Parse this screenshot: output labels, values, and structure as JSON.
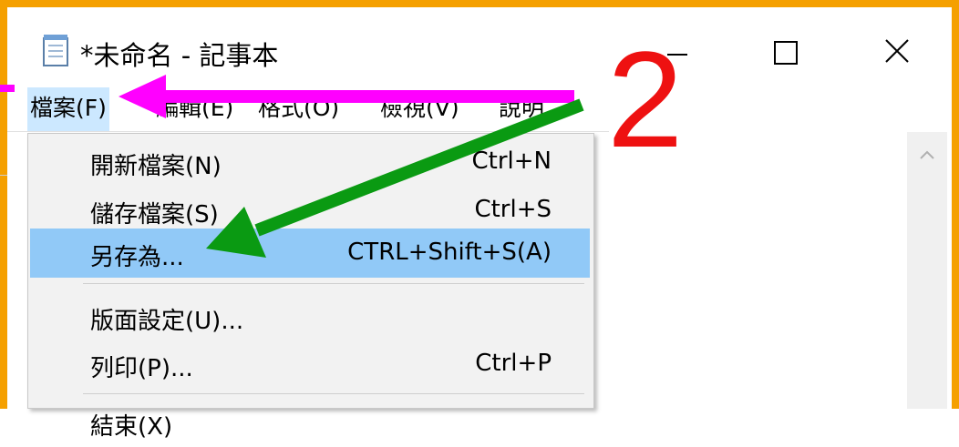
{
  "window": {
    "title": "*未命名 - 記事本",
    "icon": "notepad-icon",
    "controls": {
      "minimize": "minimize-icon",
      "maximize": "maximize-icon",
      "close": "close-icon"
    }
  },
  "menubar": {
    "items": [
      {
        "label": "檔案(F)",
        "active": true
      },
      {
        "label": "編輯(E)"
      },
      {
        "label": "格式(O)"
      },
      {
        "label": "檢視(V)"
      },
      {
        "label": "說明"
      }
    ]
  },
  "file_menu": {
    "items": [
      {
        "label": "開新檔案(N)",
        "shortcut": "Ctrl+N"
      },
      {
        "label": "儲存檔案(S)",
        "shortcut": "Ctrl+S"
      },
      {
        "label": "另存為...",
        "shortcut": "CTRL+Shift+S(A)",
        "highlighted": true
      },
      {
        "label": "版面設定(U)...",
        "shortcut": ""
      },
      {
        "label": "列印(P)...",
        "shortcut": "Ctrl+P"
      },
      {
        "label": "結束(X)",
        "shortcut": ""
      }
    ]
  },
  "annotation": {
    "step": "2",
    "colors": {
      "frame": "#f5a000",
      "step": "#ee1111",
      "magenta_arrow": "#ff00ff",
      "green_arrow": "#0a9a12"
    }
  }
}
